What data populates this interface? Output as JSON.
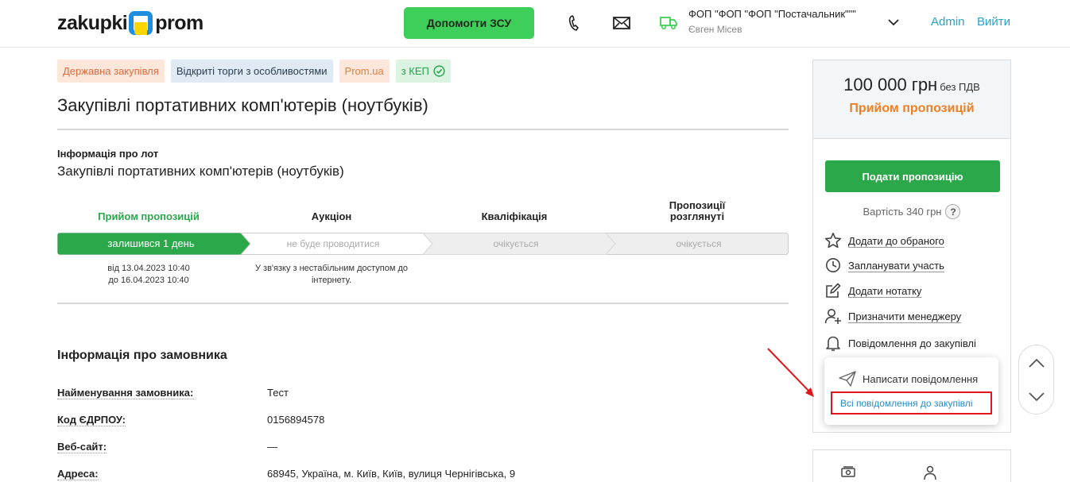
{
  "header": {
    "logo_left": "zakupki",
    "logo_right": "prom",
    "help_button": "Допомогти ЗСУ",
    "company_name": "ФОП \"ФОП \"ФОП \"Постачальник\"\"\"",
    "company_user": "Євген Місев",
    "admin_link": "Admin",
    "logout_link": "Вийти"
  },
  "tags": [
    {
      "label": "Державна закупівля"
    },
    {
      "label": "Відкриті торги з особливостями"
    },
    {
      "label": "Prom.ua"
    },
    {
      "label": "з КЕП"
    }
  ],
  "tender": {
    "title": "Закупівлі портативних комп'ютерів (ноутбуків)",
    "lot_label": "Інформація про лот",
    "lot_name": "Закупівлі портативних комп'ютерів (ноутбуків)"
  },
  "stages": [
    {
      "title": "Прийом пропозицій",
      "bar": "залишився 1 день",
      "sub1": "від 13.04.2023 10:40",
      "sub2": "до 16.04.2023 10:40"
    },
    {
      "title": "Аукціон",
      "bar": "не буде проводитися",
      "sub1": "У зв'язку з нестабільним доступом до",
      "sub2": "інтернету."
    },
    {
      "title": "Кваліфікація",
      "bar": "очікується"
    },
    {
      "title1": "Пропозиції",
      "title2": "розглянуті",
      "bar": "очікується"
    }
  ],
  "customer": {
    "title": "Інформація про замовника",
    "rows": [
      {
        "label": "Найменування замовника:",
        "value": "Тест"
      },
      {
        "label": "Код ЄДРПОУ:",
        "value": "0156894578"
      },
      {
        "label": "Веб-сайт:",
        "value": "—"
      },
      {
        "label": "Адреса:",
        "value": "68945, Україна, м. Київ, Київ, вулиця Чернігівська, 9"
      }
    ]
  },
  "sidebar": {
    "price": "100 000 грн",
    "vat": "без ПДВ",
    "status": "Прийом пропозицій",
    "submit_button": "Подати пропозицію",
    "cost": "Вартість 340 грн",
    "help_mark": "?",
    "actions": [
      {
        "label": "Додати до обраного",
        "icon": "star-icon"
      },
      {
        "label": "Запланувати участь",
        "icon": "clock-icon"
      },
      {
        "label": "Додати нотатку",
        "icon": "note-edit-icon"
      },
      {
        "label": "Призначити менеджеру",
        "icon": "user-add-icon"
      },
      {
        "label": "Повідомлення до закупівлі",
        "icon": "bell-icon"
      }
    ],
    "popup": {
      "write_message": "Написати повідомлення",
      "all_messages": "Всі повідомлення до закупівлі"
    }
  },
  "colors": {
    "brand_green": "#3ecf5b",
    "stage_green": "#2ba84a",
    "status_orange": "#f07e22",
    "link_blue": "#2aa3c9",
    "highlight_red": "#e0161b"
  }
}
